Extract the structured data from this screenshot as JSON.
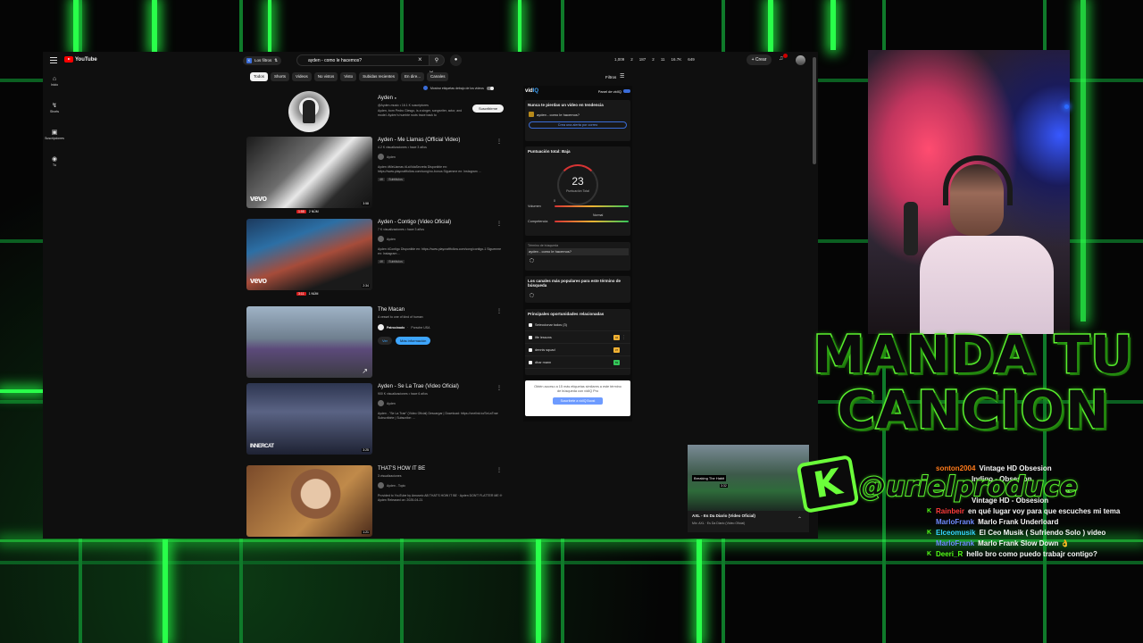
{
  "youtube": {
    "logo": "YouTube",
    "filter_chip": "Los filtros",
    "search_value": "ayden - como le hacemos?",
    "stats": [
      "1,009",
      "2",
      "187",
      "2",
      "11",
      "16.7K",
      "649"
    ],
    "create_label": "Crear",
    "sidebar": [
      {
        "icon": "home-icon",
        "label": "Inicio",
        "glyph": "⌂"
      },
      {
        "icon": "shorts-icon",
        "label": "Shorts",
        "glyph": "↯"
      },
      {
        "icon": "subscriptions-icon",
        "label": "Suscripciones",
        "glyph": "▣"
      },
      {
        "icon": "you-icon",
        "label": "Tú",
        "glyph": "◉"
      }
    ],
    "chips": [
      "Todos",
      "Shorts",
      "Videos",
      "No vistos",
      "Visto",
      "Subidas recientes",
      "En dire...",
      "Canales"
    ],
    "filters_label": "Filtros",
    "toggle_label": "Mostrar etiquetas debajo de los videos",
    "channel": {
      "name": "Ayden",
      "meta": "@Ayden-music • 16.1 K suscriptores",
      "desc": "Ayden, born Pedro Giesgo, is a singer, songwriter, actor, and model. Ayden's humble roots trace back to",
      "subscribe": "Suscribirme"
    },
    "videos": [
      {
        "title": "Ayden - Me Llamas (Official Video)",
        "meta": "4.2 K visualizaciones • hace 3 años",
        "channel": "Ayden",
        "desc": "Ayden #MeLlamas #LaVidaSecreta Disponible en: https://www.playcraftfollow.com/song/no-bonus Siguenme en: Instagram ...",
        "badges": [
          "4K",
          "Subtítulos"
        ],
        "duration": "3:58",
        "rank": "1:55",
        "rank_label": "2 NÚM",
        "watermark": "vevo"
      },
      {
        "title": "Ayden - Contigo (Video Oficial)",
        "meta": "7 K visualizaciones • hace 3 años",
        "channel": "Ayden",
        "desc": "Ayden #Contigo Disponible en: https://www.playcraftfollow.com/song/contigo-1 Siguenme en: Instagram ...",
        "badges": [
          "4K",
          "Subtítulos"
        ],
        "duration": "2:34",
        "rank": "3:11",
        "rank_label": "1 NÚM",
        "watermark": "vevo"
      },
      {
        "title": "The Macan",
        "meta": "A vessel to one of kind of human",
        "channel": "Porsche USA",
        "sponsored": "Patrocinado",
        "btn_view": "Ver",
        "btn_more": "Más información"
      },
      {
        "title": "Ayden - Se La Trae (Video Oficial)",
        "meta": "900 K visualizaciones • hace 6 años",
        "channel": "Ayden",
        "desc": "Ayden - \"Se La Trae\" (Video Oficial) Descargar | Download: https://onelink.to/SeLaTrae Subscribirte | Subscribe: ...",
        "duration": "3:25",
        "watermark": "INNERCAT"
      },
      {
        "title": "THAT'S HOW IT BE",
        "meta": "3 visualizaciones",
        "channel": "Ayden - Topic",
        "desc": "Provided to YouTube by Amuseio AB THAT'S HOW IT BE · Ayden DON'T FLATTER ME ℗ Ayden Released on: 2025-04-21",
        "duration": "1:21"
      }
    ],
    "vidiq": {
      "logo_a": "vid",
      "logo_b": "IQ",
      "panel_label": "Panel de vidIQ",
      "trend_title": "Nunca te pierdas un video en tendencia",
      "trend_query": "ayden - como le hacemos?",
      "alert_btn": "Crea una alerta por correo",
      "score_title": "Puntuación total: Baja",
      "score": "23",
      "score_label": "Puntuación Total",
      "volume_label": "Volumen",
      "volume_value": "0",
      "competition_label": "Competencia",
      "competition_value": "Normal",
      "term_label": "Término de búsqueda",
      "term_value": "ayden - como le hacemos?",
      "channels_title": "Los canales más populares para este término de búsqueda",
      "opps_title": "Principales oportunidades relacionadas",
      "opps": [
        {
          "label": "Seleccionar todos (3)",
          "score": "",
          "color": ""
        },
        {
          "label": "life lessons",
          "score": "42",
          "color": "#f2b233"
        },
        {
          "label": "dennis squad",
          "score": "37",
          "color": "#f2b233"
        },
        {
          "label": "dhar mann",
          "score": "59",
          "color": "#34c759"
        }
      ],
      "boost_text": "Obtén acceso a 15 más etiquetas similares a este término de búsqueda con vidIQ Pro",
      "boost_btn": "Suscríbete a vidIQ Boost"
    },
    "miniplayer": {
      "overlay": "Breaking The Habit",
      "time": "3:32",
      "title": "AXL - Es Da Diario (Video Oficial)",
      "sub": "Mix: AXL · Es Da Diario (Video Oficial)"
    }
  },
  "overlay": {
    "headline_1": "MANDA TU",
    "headline_2": "CANCION",
    "handle": "@urielproduce",
    "handle_icon": "K"
  },
  "chat": [
    {
      "user": "sonton2004",
      "color": "#ff7a1a",
      "text": "Vintage HD Obsesion"
    },
    {
      "user": "",
      "color": "#ff7a1a",
      "text": "Indigo - Obsesion"
    },
    {
      "user": "",
      "color": "#ff7a1a",
      "text": "ria"
    },
    {
      "user": "",
      "color": "#ff7a1a",
      "text": "Vintage HD - Obsesion"
    },
    {
      "user": "Rainbeir",
      "color": "#ff3b3b",
      "text": "en qué lugar voy para que escuches mi tema"
    },
    {
      "user": "MarloFrank",
      "color": "#6f8bff",
      "text": "Marlo Frank Underloard"
    },
    {
      "user": "Elceomusik",
      "color": "#33d6ff",
      "text": "El Ceo Musik ( Sufriendo Solo ) video"
    },
    {
      "user": "MarloFrank",
      "color": "#6f8bff",
      "text": "Marlo Frank Slow Down 👌"
    },
    {
      "user": "Deeri_R",
      "color": "#53fc18",
      "text": "hello bro como puedo trabajr contigo?"
    }
  ]
}
